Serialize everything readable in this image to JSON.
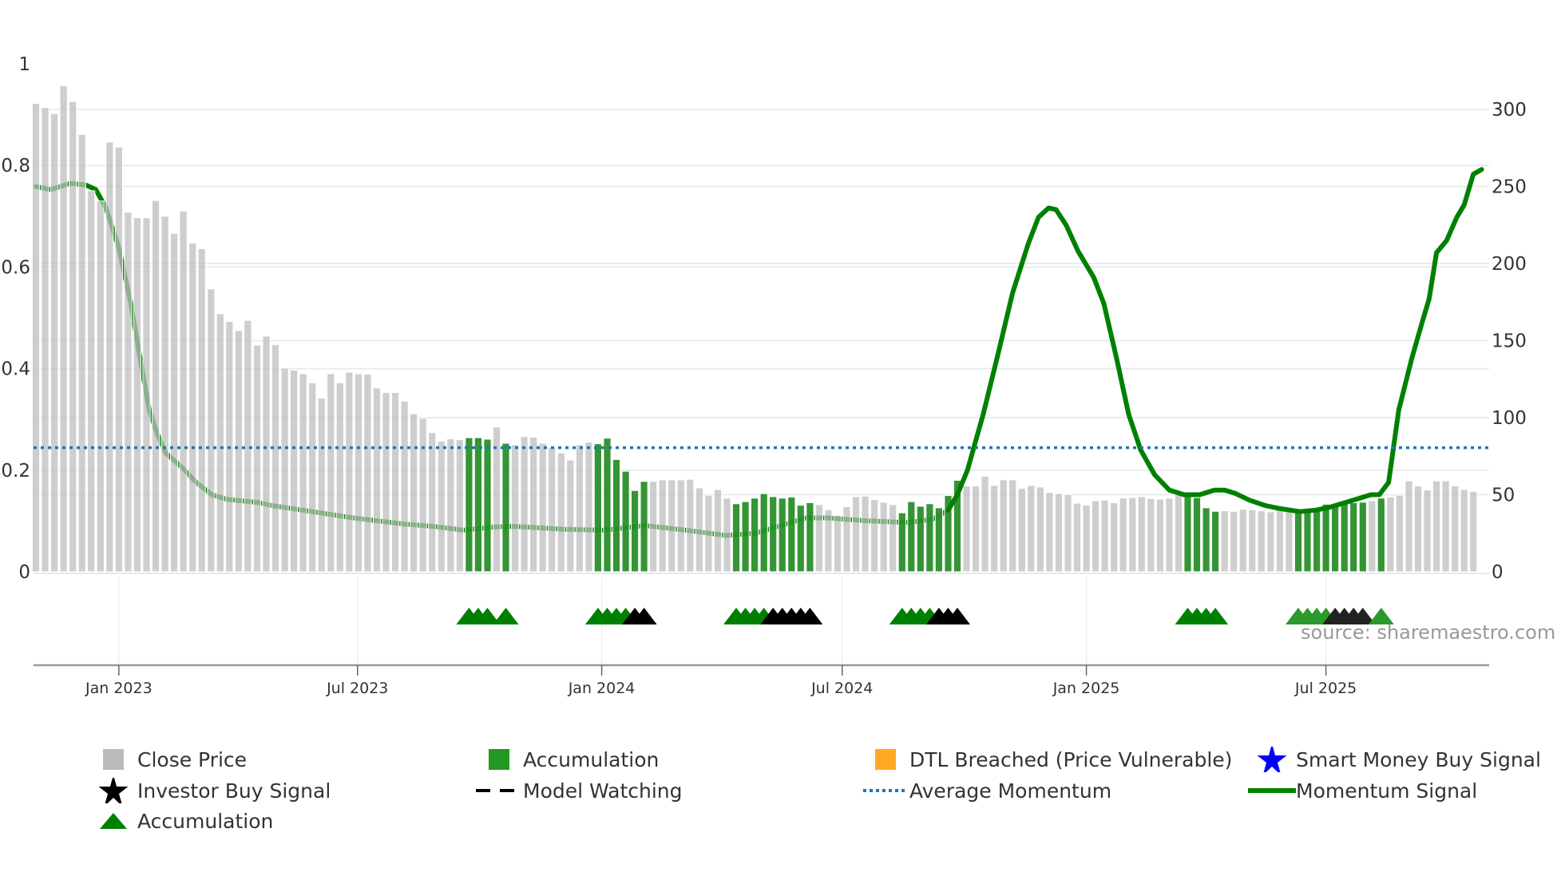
{
  "chart_data": {
    "type": "bar",
    "title": "",
    "source": "source: sharemaestro.com",
    "left_axis": {
      "ticks": [
        0,
        0.2,
        0.4,
        0.6,
        0.8,
        1
      ],
      "tick_labels": [
        "0",
        "0.2",
        "0.4",
        "0.6",
        "0.8",
        "1"
      ],
      "range": [
        0,
        1
      ]
    },
    "right_axis": {
      "ticks": [
        0,
        50,
        100,
        150,
        200,
        250,
        300
      ],
      "tick_labels": [
        "0",
        "50",
        "100",
        "150",
        "200",
        "250",
        "300"
      ],
      "range": [
        0,
        330
      ]
    },
    "x_axis": {
      "unit": "week index",
      "range": [
        -0.6,
        157.5
      ],
      "ticks": [
        {
          "week": 9.0,
          "label": "Jan 2023"
        },
        {
          "week": 34.9,
          "label": "Jul 2023"
        },
        {
          "week": 61.4,
          "label": "Jan 2024"
        },
        {
          "week": 87.5,
          "label": "Jul 2024"
        },
        {
          "week": 114.0,
          "label": "Jan 2025"
        },
        {
          "week": 140.0,
          "label": "Jul 2025"
        }
      ]
    },
    "close_price": [
      0.922,
      0.914,
      0.902,
      0.957,
      0.926,
      0.861,
      0.75,
      0.73,
      0.846,
      0.836,
      0.708,
      0.697,
      0.697,
      0.731,
      0.7,
      0.666,
      0.71,
      0.647,
      0.636,
      0.557,
      0.508,
      0.493,
      0.475,
      0.495,
      0.446,
      0.464,
      0.447,
      0.401,
      0.397,
      0.39,
      0.372,
      0.342,
      0.39,
      0.372,
      0.393,
      0.39,
      0.389,
      0.362,
      0.353,
      0.353,
      0.336,
      0.311,
      0.302,
      0.274,
      0.257,
      0.262,
      0.26,
      0.264,
      0.264,
      0.261,
      0.285,
      0.253,
      0.25,
      0.266,
      0.265,
      0.253,
      0.245,
      0.234,
      0.22,
      0.25,
      0.255,
      0.252,
      0.263,
      0.221,
      0.198,
      0.16,
      0.178,
      0.178,
      0.181,
      0.181,
      0.181,
      0.182,
      0.165,
      0.151,
      0.162,
      0.145,
      0.134,
      0.138,
      0.145,
      0.154,
      0.148,
      0.145,
      0.147,
      0.131,
      0.136,
      0.132,
      0.122,
      0.111,
      0.128,
      0.148,
      0.149,
      0.142,
      0.137,
      0.132,
      0.116,
      0.138,
      0.129,
      0.134,
      0.126,
      0.15,
      0.18,
      0.169,
      0.169,
      0.188,
      0.17,
      0.181,
      0.181,
      0.164,
      0.17,
      0.167,
      0.156,
      0.154,
      0.152,
      0.135,
      0.131,
      0.14,
      0.141,
      0.136,
      0.145,
      0.146,
      0.148,
      0.144,
      0.143,
      0.145,
      0.152,
      0.154,
      0.146,
      0.126,
      0.119,
      0.12,
      0.119,
      0.123,
      0.122,
      0.12,
      0.118,
      0.121,
      0.121,
      0.121,
      0.122,
      0.126,
      0.133,
      0.131,
      0.137,
      0.136,
      0.137,
      0.14,
      0.145,
      0.147,
      0.151,
      0.179,
      0.169,
      0.161,
      0.179,
      0.179,
      0.169,
      0.162,
      0.158
    ],
    "accumulation_weeks": [
      47,
      48,
      49,
      51,
      61,
      62,
      63,
      64,
      65,
      66,
      76,
      77,
      78,
      79,
      80,
      81,
      82,
      83,
      84,
      94,
      95,
      96,
      97,
      98,
      99,
      100,
      125,
      126,
      127,
      128,
      137,
      138,
      139,
      140,
      141,
      142,
      143,
      144,
      146
    ],
    "momentum_signal": [
      [
        0,
        250
      ],
      [
        1.6,
        248
      ],
      [
        3.7,
        252
      ],
      [
        5.4,
        251
      ],
      [
        6.5,
        248
      ],
      [
        7.6,
        236
      ],
      [
        9,
        210
      ],
      [
        10.3,
        174
      ],
      [
        11.4,
        135
      ],
      [
        12.3,
        105
      ],
      [
        13.2,
        89
      ],
      [
        14.1,
        77
      ],
      [
        15.8,
        68
      ],
      [
        17.4,
        58
      ],
      [
        19.1,
        50
      ],
      [
        20.7,
        47
      ],
      [
        24,
        45
      ],
      [
        25.6,
        43
      ],
      [
        28.9,
        40
      ],
      [
        34.4,
        35
      ],
      [
        39.9,
        31
      ],
      [
        43.1,
        29.5
      ],
      [
        46.4,
        27
      ],
      [
        49.7,
        29
      ],
      [
        51.9,
        29.5
      ],
      [
        57.4,
        27.5
      ],
      [
        61.7,
        27
      ],
      [
        66.1,
        30
      ],
      [
        70.5,
        27
      ],
      [
        74.9,
        23.6
      ],
      [
        78.1,
        25
      ],
      [
        81.4,
        31
      ],
      [
        83.6,
        35
      ],
      [
        85.8,
        35
      ],
      [
        90.2,
        33
      ],
      [
        94.6,
        32
      ],
      [
        97.3,
        34
      ],
      [
        99,
        40
      ],
      [
        100,
        50
      ],
      [
        101.1,
        66
      ],
      [
        102.8,
        102
      ],
      [
        104.4,
        141
      ],
      [
        106,
        181
      ],
      [
        107.7,
        213
      ],
      [
        108.8,
        230
      ],
      [
        109.9,
        236
      ],
      [
        110.7,
        235
      ],
      [
        111.8,
        225
      ],
      [
        113.1,
        208
      ],
      [
        114.8,
        191
      ],
      [
        115.9,
        174
      ],
      [
        117.3,
        138
      ],
      [
        118.6,
        102
      ],
      [
        119.9,
        79
      ],
      [
        121.4,
        63
      ],
      [
        123,
        53
      ],
      [
        124.6,
        50
      ],
      [
        126.3,
        50
      ],
      [
        127.9,
        53
      ],
      [
        129,
        53
      ],
      [
        130.1,
        51
      ],
      [
        131.7,
        46.5
      ],
      [
        133.4,
        43
      ],
      [
        135,
        41
      ],
      [
        137.2,
        39
      ],
      [
        138.9,
        40
      ],
      [
        140.5,
        42
      ],
      [
        142.7,
        46
      ],
      [
        144.9,
        50
      ],
      [
        145.8,
        50
      ],
      [
        146.8,
        58
      ],
      [
        147.9,
        105
      ],
      [
        149.3,
        138
      ],
      [
        150.4,
        161
      ],
      [
        151.2,
        177
      ],
      [
        152,
        207
      ],
      [
        153.1,
        215
      ],
      [
        154.2,
        230
      ],
      [
        155,
        238
      ],
      [
        156,
        258
      ],
      [
        156.9,
        261
      ]
    ],
    "average_momentum": 80.5,
    "signal_markers": [
      {
        "week": 47,
        "type": "accumulation"
      },
      {
        "week": 48,
        "type": "accumulation"
      },
      {
        "week": 49,
        "type": "accumulation"
      },
      {
        "week": 51,
        "type": "accumulation"
      },
      {
        "week": 61,
        "type": "accumulation"
      },
      {
        "week": 62,
        "type": "accumulation"
      },
      {
        "week": 63,
        "type": "accumulation"
      },
      {
        "week": 64,
        "type": "accumulation"
      },
      {
        "week": 65,
        "type": "investor"
      },
      {
        "week": 66,
        "type": "investor"
      },
      {
        "week": 76,
        "type": "accumulation"
      },
      {
        "week": 77,
        "type": "accumulation"
      },
      {
        "week": 78,
        "type": "accumulation"
      },
      {
        "week": 79,
        "type": "accumulation"
      },
      {
        "week": 80,
        "type": "investor"
      },
      {
        "week": 81,
        "type": "investor"
      },
      {
        "week": 82,
        "type": "investor"
      },
      {
        "week": 83,
        "type": "investor"
      },
      {
        "week": 84,
        "type": "investor"
      },
      {
        "week": 94,
        "type": "accumulation"
      },
      {
        "week": 95,
        "type": "accumulation"
      },
      {
        "week": 96,
        "type": "accumulation"
      },
      {
        "week": 97,
        "type": "accumulation"
      },
      {
        "week": 98,
        "type": "investor"
      },
      {
        "week": 99,
        "type": "investor"
      },
      {
        "week": 100,
        "type": "investor"
      },
      {
        "week": 125,
        "type": "accumulation"
      },
      {
        "week": 126,
        "type": "accumulation"
      },
      {
        "week": 127,
        "type": "accumulation"
      },
      {
        "week": 128,
        "type": "accumulation"
      },
      {
        "week": 137,
        "type": "accumulation",
        "faded": true
      },
      {
        "week": 138,
        "type": "accumulation",
        "faded": true
      },
      {
        "week": 139,
        "type": "accumulation",
        "faded": true
      },
      {
        "week": 140,
        "type": "accumulation",
        "faded": true
      },
      {
        "week": 141,
        "type": "investor",
        "faded": true
      },
      {
        "week": 142,
        "type": "investor",
        "faded": true
      },
      {
        "week": 143,
        "type": "investor",
        "faded": true
      },
      {
        "week": 144,
        "type": "investor",
        "faded": true
      },
      {
        "week": 146,
        "type": "accumulation",
        "faded": true
      }
    ],
    "legend": {
      "placement": "bottom",
      "items": [
        {
          "label": "Close Price",
          "color": "#bbbbbb"
        },
        {
          "label": "Accumulation",
          "color": "#229922"
        },
        {
          "label": "DTL Breached (Price Vulnerable)",
          "color": "#ffaa22"
        },
        {
          "label": "Smart Money Buy Signal",
          "color": "#0000ff"
        },
        {
          "label": "Investor Buy Signal",
          "color": "#000000"
        },
        {
          "label": "Model Watching",
          "color": "#000000"
        },
        {
          "label": "Average Momentum",
          "color": "#1f77b4"
        },
        {
          "label": "Momentum Signal",
          "color": "#008000"
        },
        {
          "label": "Accumulation",
          "color": "#008000"
        }
      ]
    },
    "colors": {
      "price": "#c8c8c8",
      "accumulation_bar": "#2a8f2a",
      "momentum": "#008000",
      "average": "#1f77b4",
      "investor": "#000000"
    }
  }
}
